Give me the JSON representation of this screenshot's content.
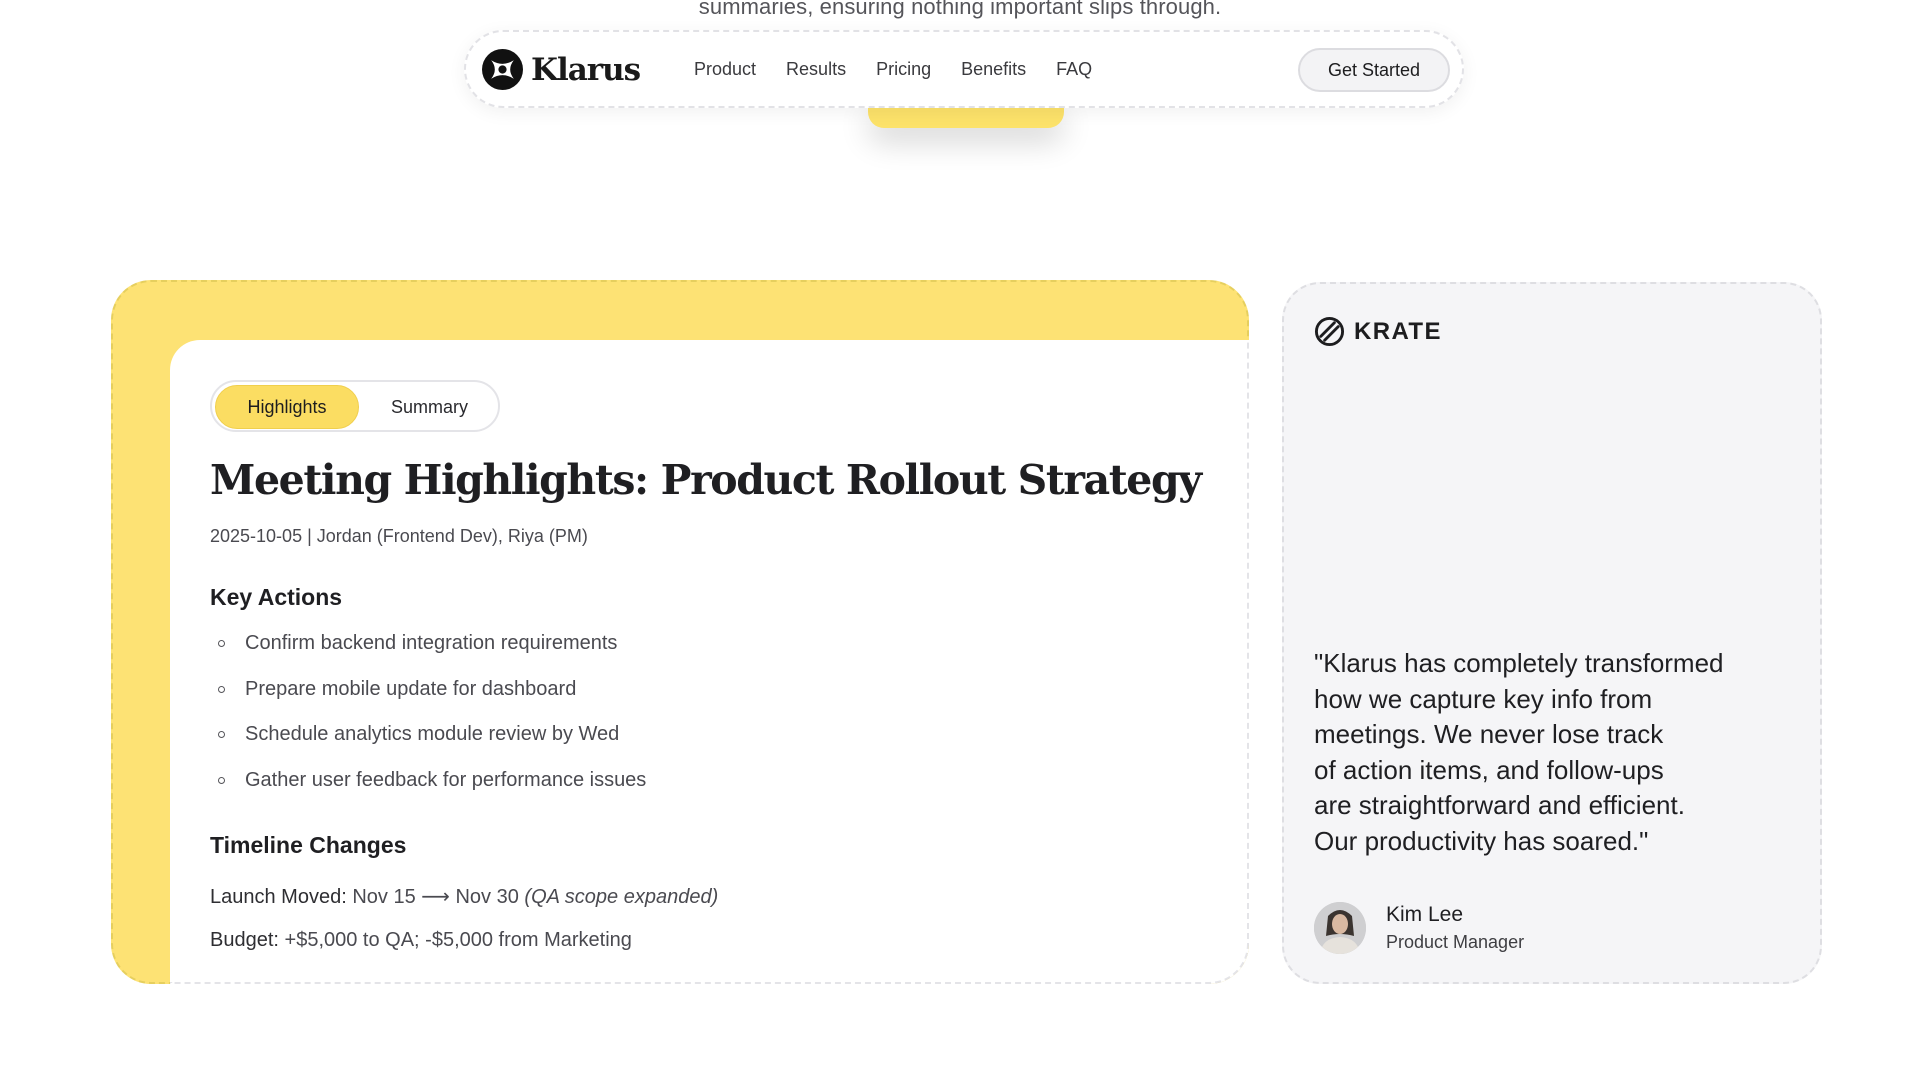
{
  "hero": {
    "subtitle_tail": "summaries, ensuring nothing important slips through."
  },
  "navbar": {
    "brand": "Klarus",
    "links": [
      "Product",
      "Results",
      "Pricing",
      "Benefits",
      "FAQ"
    ],
    "cta": "Get Started"
  },
  "meeting_card": {
    "tabs": [
      "Highlights",
      "Summary"
    ],
    "active_tab": "Highlights",
    "title": "Meeting Highlights: Product Rollout Strategy",
    "meta": "2025-10-05 | Jordan (Frontend Dev), Riya (PM)",
    "key_actions_heading": "Key Actions",
    "key_actions": [
      "Confirm backend integration requirements",
      "Prepare mobile update for dashboard",
      "Schedule analytics module review by Wed",
      "Gather user feedback for performance issues"
    ],
    "timeline_heading": "Timeline Changes",
    "launch_label": "Launch Moved:",
    "launch_value": "Nov 15 ⟶ Nov 30",
    "launch_note": "(QA scope expanded)",
    "budget_label": "Budget:",
    "budget_value": "+$5,000 to QA; -$5,000 from Marketing"
  },
  "testimonial": {
    "company": "KRATE",
    "quote_lines": [
      "\"Klarus has completely transformed",
      "how we capture key info from",
      "meetings. We never lose track",
      "of action items, and follow-ups",
      "are straightforward and efficient.",
      "Our productivity has soared.\""
    ],
    "person_name": "Kim Lee",
    "person_role": "Product Manager"
  },
  "colors": {
    "accent_yellow": "#fde274",
    "tab_active": "#fbdd62",
    "card_gray": "#f5f5f7",
    "text_dark": "#1f1f22"
  },
  "icons": {
    "brand_logo": "klarus-logo-icon",
    "company_logo": "krate-logo-icon",
    "bullet": "circle-bullet-icon"
  }
}
